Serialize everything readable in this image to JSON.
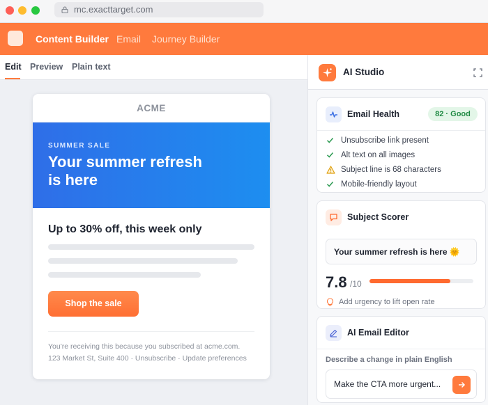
{
  "browser": {
    "url": "mc.exacttarget.com"
  },
  "appbar": {
    "nav": [
      "Content Builder",
      "Email",
      "Journey Builder"
    ],
    "accent": "#ff7a3d"
  },
  "editor": {
    "tabs": [
      "Edit",
      "Preview",
      "Plain text"
    ]
  },
  "email": {
    "brand": "ACME",
    "kicker": "SUMMER SALE",
    "headline": "Your summer refresh is here",
    "offer": "Up to 30% off, this week only",
    "cta": "Shop the sale",
    "footer_line1": "You're receiving this because you subscribed at acme.com.",
    "footer_line2": "123 Market St, Suite 400 · Unsubscribe · Update preferences"
  },
  "panel": {
    "title": "AI Studio",
    "health": {
      "title": "Email Health",
      "badge": "82 · Good",
      "items": [
        {
          "status": "ok",
          "text": "Unsubscribe link present"
        },
        {
          "status": "ok",
          "text": "Alt text on all images"
        },
        {
          "status": "warn",
          "text": "Subject line is 68 characters"
        },
        {
          "status": "ok",
          "text": "Mobile-friendly layout"
        }
      ]
    },
    "subject": {
      "title": "Subject Scorer",
      "line": "Your summer refresh is here 🌞",
      "score": "7.8",
      "out_of": "/10",
      "score_fraction": 0.78,
      "tip": "Add urgency to lift open rate"
    },
    "editor": {
      "title": "AI Email Editor",
      "label": "Describe a change in plain English",
      "prompt": "Make the CTA more urgent..."
    }
  }
}
